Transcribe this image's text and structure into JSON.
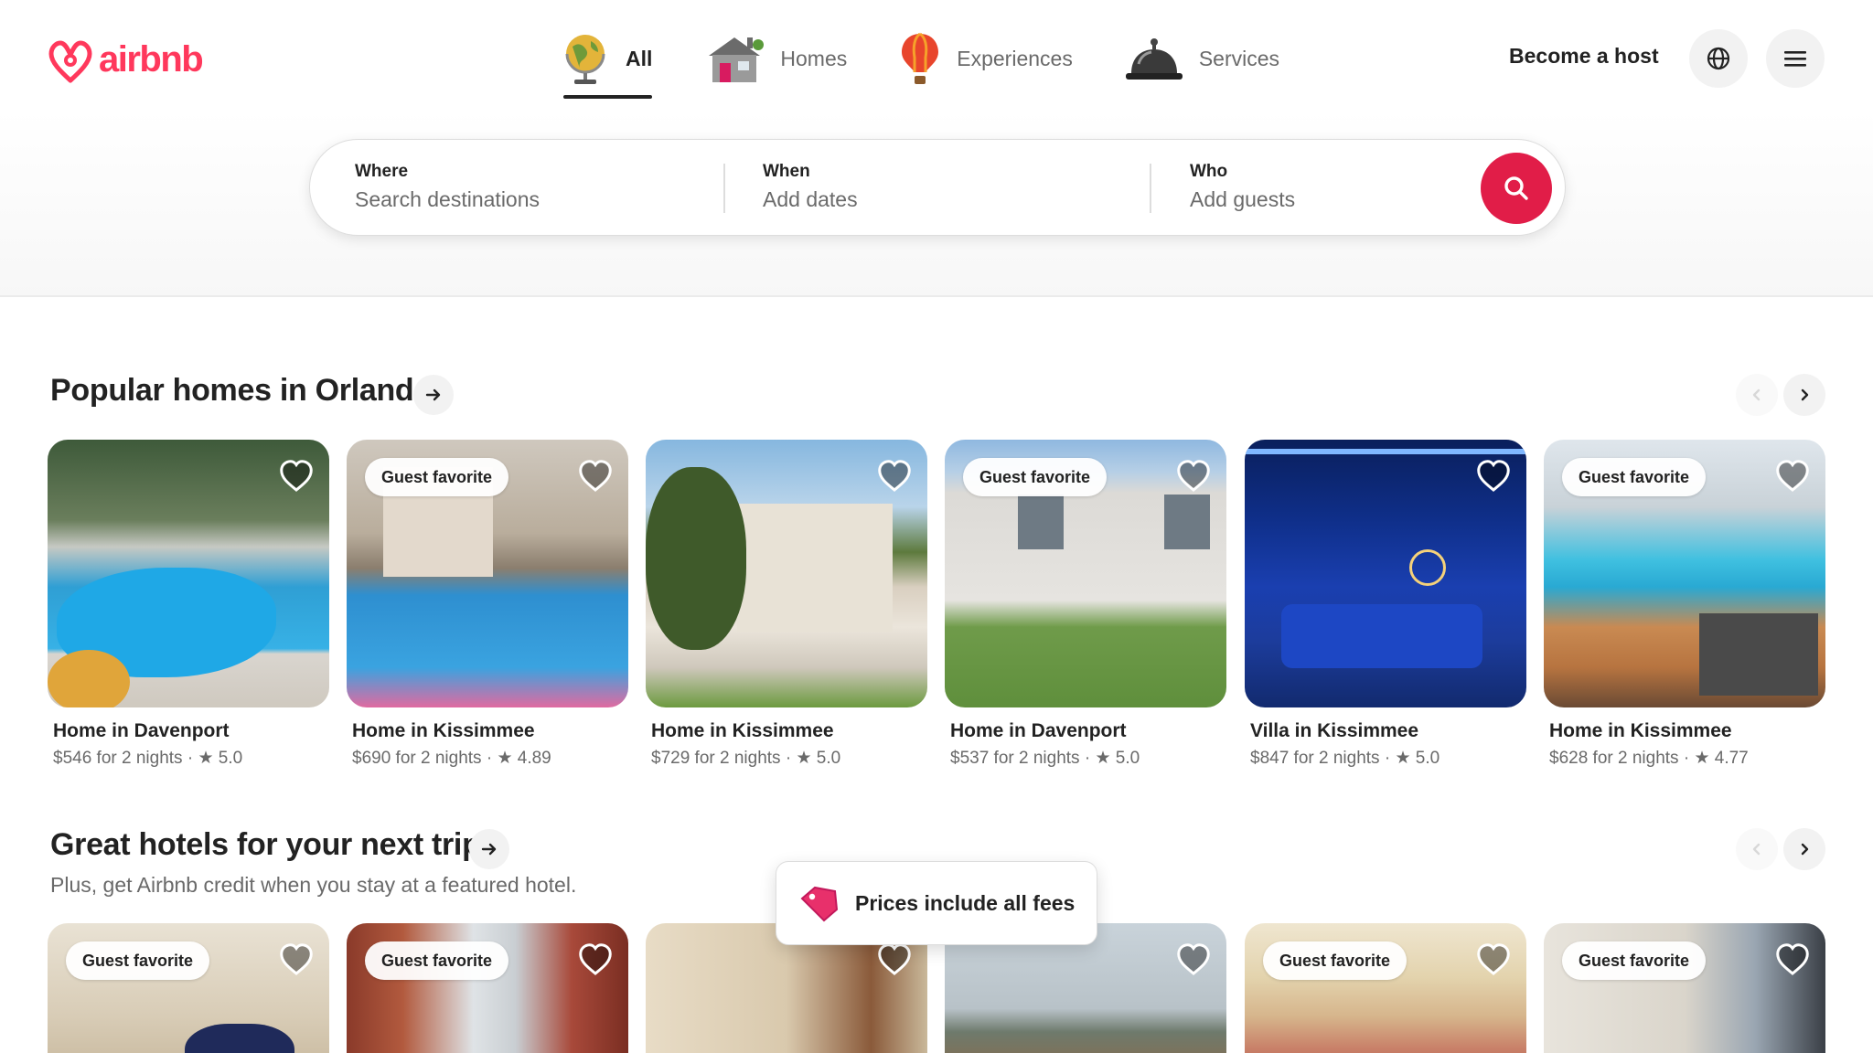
{
  "brand": {
    "name": "airbnb",
    "color": "#ff385c"
  },
  "categories": [
    {
      "label": "All",
      "icon": "globe-icon",
      "active": true
    },
    {
      "label": "Homes",
      "icon": "house-icon",
      "active": false
    },
    {
      "label": "Experiences",
      "icon": "hot-air-balloon-icon",
      "active": false
    },
    {
      "label": "Services",
      "icon": "service-bell-icon",
      "active": false
    }
  ],
  "header": {
    "host_link": "Become a host",
    "language_icon": "globe-outline-icon",
    "menu_icon": "hamburger-menu-icon"
  },
  "search": {
    "where": {
      "title": "Where",
      "placeholder": "Search destinations"
    },
    "when": {
      "title": "When",
      "placeholder": "Add dates"
    },
    "who": {
      "title": "Who",
      "placeholder": "Add guests"
    },
    "button_icon": "search-icon",
    "accent": "#e11d48"
  },
  "sections": [
    {
      "title": "Popular homes in Orlando",
      "subtitle": "",
      "cards": [
        {
          "badge": "",
          "title": "Home in Davenport",
          "price": "$546 for 2 nights",
          "rating": "★ 5.0"
        },
        {
          "badge": "Guest favorite",
          "title": "Home in Kissimmee",
          "price": "$690 for 2 nights",
          "rating": "★ 4.89"
        },
        {
          "badge": "",
          "title": "Home in Kissimmee",
          "price": "$729 for 2 nights",
          "rating": "★ 5.0"
        },
        {
          "badge": "Guest favorite",
          "title": "Home in Davenport",
          "price": "$537 for 2 nights",
          "rating": "★ 5.0"
        },
        {
          "badge": "",
          "title": "Villa in Kissimmee",
          "price": "$847 for 2 nights",
          "rating": "★ 5.0"
        },
        {
          "badge": "Guest favorite",
          "title": "Home in Kissimmee",
          "price": "$628 for 2 nights",
          "rating": "★ 4.77"
        }
      ]
    },
    {
      "title": "Great hotels for your next trip",
      "subtitle": "Plus, get Airbnb credit when you stay at a featured hotel.",
      "cards": [
        {
          "badge": "Guest favorite"
        },
        {
          "badge": "Guest favorite"
        },
        {
          "badge": ""
        },
        {
          "badge": ""
        },
        {
          "badge": "Guest favorite"
        },
        {
          "badge": "Guest favorite"
        }
      ]
    }
  ],
  "separator": " · ",
  "toast": {
    "text": "Prices include all fees",
    "icon": "price-tag-icon"
  }
}
